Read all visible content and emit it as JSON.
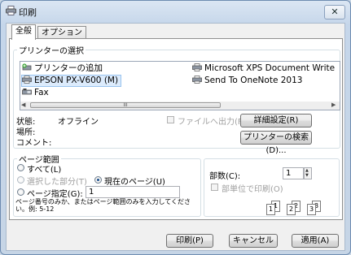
{
  "window": {
    "title": "印刷",
    "close_glyph": "✕"
  },
  "tabs": [
    {
      "label": "全般",
      "active": true
    },
    {
      "label": "オプション",
      "active": false
    }
  ],
  "printer_select": {
    "group_title": "プリンターの選択",
    "printers": [
      {
        "name": "プリンターの追加",
        "icon": "add-printer-icon",
        "selected": false
      },
      {
        "name": "Microsoft XPS Document Write",
        "icon": "printer-icon",
        "selected": false
      },
      {
        "name": "EPSON PX-V600 (M)",
        "icon": "printer-icon",
        "selected": true
      },
      {
        "name": "Send To OneNote 2013",
        "icon": "printer-icon",
        "selected": false
      },
      {
        "name": "Fax",
        "icon": "fax-icon",
        "selected": false
      }
    ],
    "scroll_thumb_glyph": "III",
    "status_label": "状態:",
    "status_value": "オフライン",
    "location_label": "場所:",
    "comment_label": "コメント:",
    "print_to_file_label": "ファイルへ出力(F)",
    "preferences_button": "詳細設定(R)",
    "find_printer_button": "プリンターの検索(D)..."
  },
  "page_range": {
    "group_title": "ページ範囲",
    "all_label": "すべて(L)",
    "selection_label": "選択した部分(T)",
    "current_page_label": "現在のページ(U)",
    "pages_label": "ページ指定(G):",
    "pages_value": "1",
    "selected_option": "current_page",
    "hint": "ページ番号のみか、またはページ範囲のみを入力してください。例: 5-12"
  },
  "copies": {
    "label": "部数(C):",
    "value": "1",
    "collate_label": "部単位で印刷(O)",
    "collate_pages": [
      "1",
      "1",
      "2",
      "2",
      "3",
      "3"
    ]
  },
  "footer": {
    "print_button": "印刷(P)",
    "cancel_button": "キャンセル",
    "apply_button": "適用(A)"
  }
}
